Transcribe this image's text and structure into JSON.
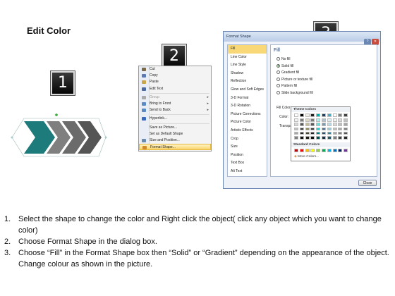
{
  "title": "Edit Color",
  "markers": [
    "1",
    "2",
    "3"
  ],
  "context_menu": {
    "items": [
      {
        "label": "Cut",
        "icon": "scissors-icon",
        "state": "normal",
        "color": "#7a6a4a"
      },
      {
        "label": "Copy",
        "icon": "copy-icon",
        "state": "normal",
        "color": "#5a7ab0"
      },
      {
        "label": "Paste",
        "icon": "paste-icon",
        "state": "normal",
        "color": "#c9a64a"
      },
      {
        "label": "Edit Text",
        "icon": "edit-text-icon",
        "state": "normal",
        "color": "#4a6aa0"
      },
      {
        "label": "Group",
        "icon": "group-icon",
        "state": "disabled",
        "color": "#aaaaaa"
      },
      {
        "label": "Bring to Front",
        "icon": "bring-front-icon",
        "state": "normal",
        "color": "#5a8ac0"
      },
      {
        "label": "Send to Back",
        "icon": "send-back-icon",
        "state": "normal",
        "color": "#5a8ac0"
      },
      {
        "label": "Hyperlink...",
        "icon": "hyperlink-icon",
        "state": "normal",
        "color": "#3a6ac0"
      },
      {
        "label": "Save as Picture...",
        "icon": "",
        "state": "normal",
        "color": ""
      },
      {
        "label": "Set as Default Shape",
        "icon": "",
        "state": "normal",
        "color": ""
      },
      {
        "label": "Size and Position...",
        "icon": "size-icon",
        "state": "normal",
        "color": "#6a8ab0"
      },
      {
        "label": "Format Shape...",
        "icon": "format-shape-icon",
        "state": "highlighted",
        "color": "#d08a2a"
      }
    ]
  },
  "dialog": {
    "title": "Format Shape",
    "nav": [
      "Fill",
      "Line Color",
      "Line Style",
      "Shadow",
      "Reflection",
      "Glow and Soft Edges",
      "3-D Format",
      "3-D Rotation",
      "Picture Corrections",
      "Picture Color",
      "Artistic Effects",
      "Crop",
      "Size",
      "Position",
      "Text Box",
      "Alt Text"
    ],
    "selected_nav": "Fill",
    "fill_header": "Fill",
    "fill_options": [
      {
        "label": "No fill",
        "checked": false
      },
      {
        "label": "Solid fill",
        "checked": true
      },
      {
        "label": "Gradient fill",
        "checked": false
      },
      {
        "label": "Picture or texture fill",
        "checked": false
      },
      {
        "label": "Pattern fill",
        "checked": false
      },
      {
        "label": "Slide background fill",
        "checked": false
      }
    ],
    "fill_color_label": "Fill Color",
    "color_label": "Color:",
    "transparency_label": "Transpa",
    "close_label": "Close"
  },
  "picker": {
    "theme_label": "Theme Colors",
    "standard_label": "Standard Colors",
    "more_label": "More Colors...",
    "theme_top": [
      "#ffffff",
      "#000000",
      "#eeece1",
      "#1f1f1f",
      "#00b0b0",
      "#1f3f5f",
      "#4bacc6",
      "#ffffff",
      "#7f7f7f",
      "#404040"
    ],
    "theme_shades": [
      [
        "#f2f2f2",
        "#7f7f7f",
        "#ddd9c3",
        "#7f7f7f",
        "#b3f0f0",
        "#b0c0d0",
        "#dbeef3",
        "#f2f2f2",
        "#d9d9d9",
        "#bfbfbf"
      ],
      [
        "#d9d9d9",
        "#595959",
        "#c4bd97",
        "#595959",
        "#66e0e0",
        "#8099b3",
        "#b7dde8",
        "#d9d9d9",
        "#bfbfbf",
        "#a6a6a6"
      ],
      [
        "#bfbfbf",
        "#3f3f3f",
        "#938953",
        "#3f3f3f",
        "#1ad1d1",
        "#4f6f8f",
        "#92cddc",
        "#bfbfbf",
        "#a6a6a6",
        "#808080"
      ],
      [
        "#a6a6a6",
        "#262626",
        "#494429",
        "#262626",
        "#008080",
        "#2f4f6f",
        "#31859b",
        "#a6a6a6",
        "#7f7f7f",
        "#595959"
      ],
      [
        "#7f7f7f",
        "#0d0d0d",
        "#1d1b10",
        "#0d0d0d",
        "#005050",
        "#1a2f45",
        "#205867",
        "#7f7f7f",
        "#404040",
        "#262626"
      ]
    ],
    "standard": [
      "#c00000",
      "#ff0000",
      "#ffc000",
      "#ffff00",
      "#92d050",
      "#00b050",
      "#00b0f0",
      "#0070c0",
      "#002060",
      "#7030a0"
    ]
  },
  "arrows": {
    "colors": [
      "#1e7b7b",
      "#7f7f7f",
      "#6b6b6b",
      "#555555"
    ]
  },
  "instructions": [
    {
      "num": "1.",
      "text": "Select the shape to change the color and Right click the object( click any object which you want to change color)"
    },
    {
      "num": "2.",
      "text": "Choose Format Shape in the dialog box."
    },
    {
      "num": "3.",
      "text": "Choose “Fill” in the Format Shape box then “Solid” or “Gradient” depending on the appearance of the object. Change colour as shown in the picture."
    }
  ]
}
